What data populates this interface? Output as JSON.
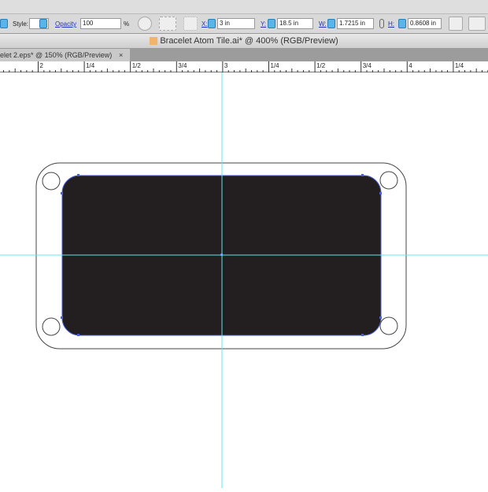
{
  "control_bar": {
    "style_label": "Style:",
    "opacity_label": "Opacity",
    "opacity_value": "100",
    "percent": "%",
    "x_label": "X:",
    "x_value": "3 in",
    "y_label": "Y:",
    "y_value": "18.5 in",
    "w_label": "W:",
    "w_value": "1.7215 in",
    "h_label": "H:",
    "h_value": "0.8608 in"
  },
  "window_title": "Bracelet Atom Tile.ai* @ 400% (RGB/Preview)",
  "tab": {
    "label": "elet 2.eps* @ 150% (RGB/Preview)",
    "close": "×"
  },
  "ruler_labels": [
    "2",
    "1/4",
    "1/2",
    "3/4",
    "3",
    "1/4",
    "1/2",
    "3/4",
    "4",
    "1/4"
  ],
  "colors": {
    "guide": "#5ee8f0",
    "fill": "#231f20",
    "selection": "#4a5fd8"
  }
}
